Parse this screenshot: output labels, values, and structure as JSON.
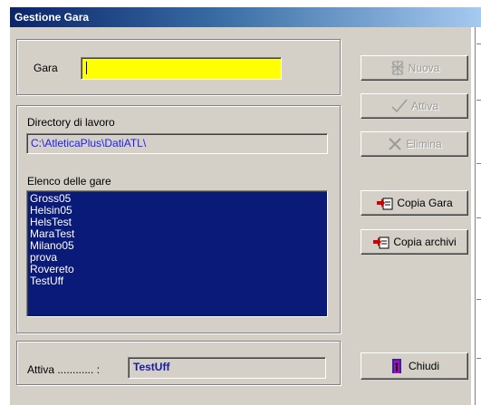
{
  "window": {
    "title": "Gestione Gara"
  },
  "gara": {
    "label": "Gara",
    "value": ""
  },
  "directory": {
    "label": "Directory di lavoro",
    "value": "C:\\AtleticaPlus\\DatiATL\\"
  },
  "elenco": {
    "label": "Elenco delle gare",
    "items": [
      "Gross05",
      "Helsin05",
      "HelsTest",
      "MaraTest",
      "Milano05",
      "prova",
      "Rovereto",
      "TestUff"
    ]
  },
  "status": {
    "label": "Attiva ............ :",
    "value": "TestUff"
  },
  "buttons": {
    "nuova": "Nuova",
    "attiva": "Attiva",
    "elimina": "Elimina",
    "copia_gara": "Copia Gara",
    "copia_archivi": "Copia archivi",
    "chiudi": "Chiudi"
  },
  "colors": {
    "highlight_input": "#ffff00",
    "list_background": "#0a1a78",
    "directory_text": "#1e1ef0"
  },
  "icons": [
    "new-document-icon",
    "checkmark-icon",
    "delete-x-icon",
    "copy-icon",
    "copy-icon",
    "exit-door-icon"
  ]
}
